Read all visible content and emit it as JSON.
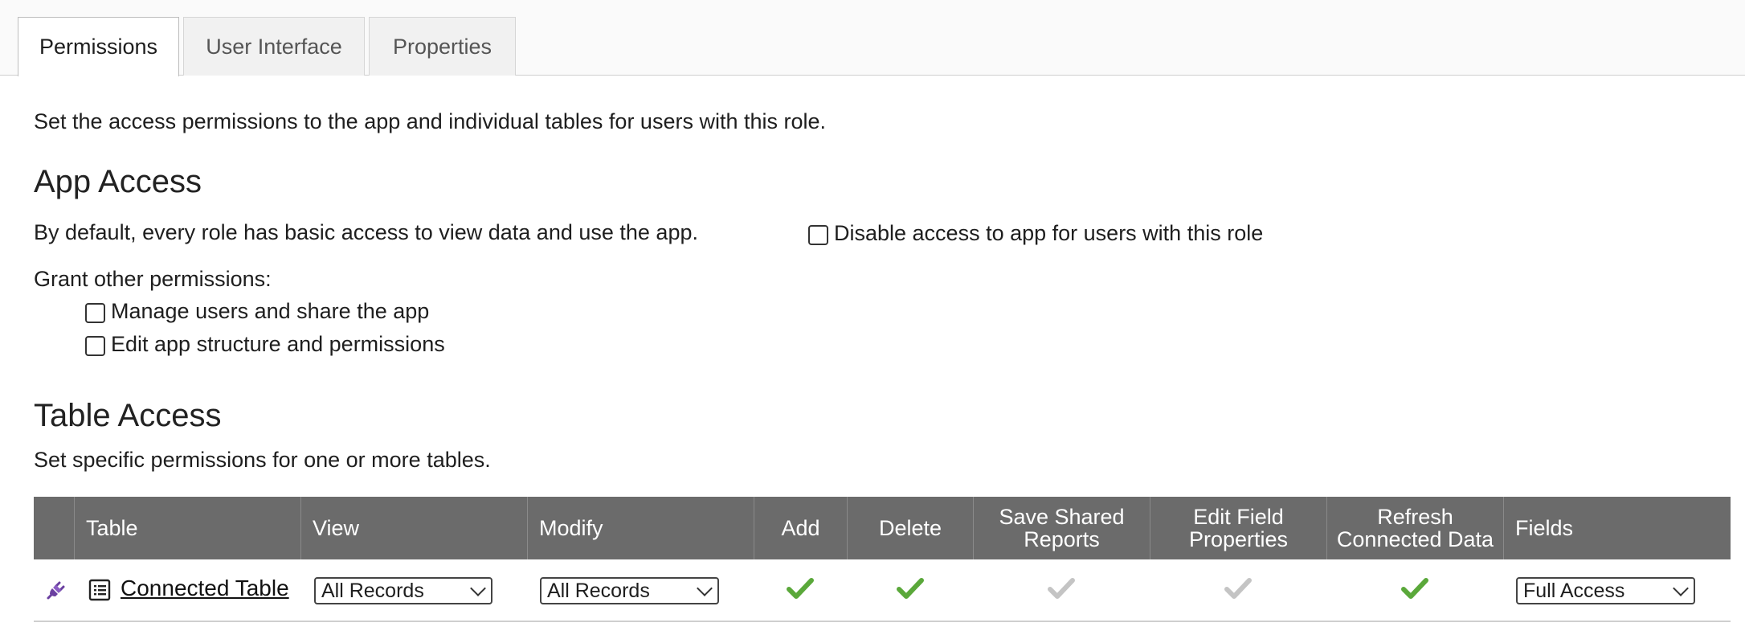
{
  "tabs": [
    {
      "label": "Permissions",
      "active": true
    },
    {
      "label": "User Interface",
      "active": false
    },
    {
      "label": "Properties",
      "active": false
    }
  ],
  "intro": "Set the access permissions to the app and individual tables for users with this role.",
  "app_access": {
    "heading": "App Access",
    "default_text": "By default, every role has basic access to view data and use the app.",
    "disable_label": "Disable access to app for users with this role",
    "disable_checked": false,
    "grant_label": "Grant other permissions:",
    "options": [
      {
        "label": "Manage users and share the app",
        "checked": false
      },
      {
        "label": "Edit app structure and permissions",
        "checked": false
      }
    ]
  },
  "table_access": {
    "heading": "Table Access",
    "description": "Set specific permissions for one or more tables.",
    "columns": {
      "table": "Table",
      "view": "View",
      "modify": "Modify",
      "add": "Add",
      "delete": "Delete",
      "save_shared_reports": "Save Shared Reports",
      "edit_field_properties": "Edit Field Properties",
      "refresh_connected_data": "Refresh Connected Data",
      "fields": "Fields"
    },
    "rows": [
      {
        "table_name": "Connected Table",
        "view": "All Records",
        "modify": "All Records",
        "add": true,
        "delete": true,
        "save_shared_reports": false,
        "edit_field_properties": false,
        "refresh_connected_data": true,
        "fields": "Full Access"
      }
    ]
  },
  "colors": {
    "header_bg": "#6b6b6b",
    "check_on": "#5aa83a",
    "check_off": "#c4c4c4",
    "plug_icon": "#6a3fa0"
  },
  "icons": {
    "connected": "plug-icon",
    "table": "table-icon",
    "check": "checkmark-icon",
    "dropdown": "chevron-down-icon"
  }
}
